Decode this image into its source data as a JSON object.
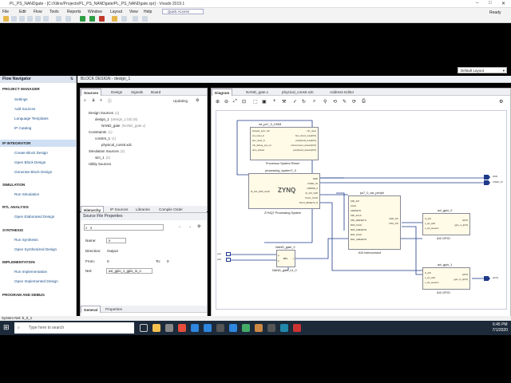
{
  "window": {
    "title": "PL_PS_NANDgate - [C:/Xilinx/Projects/PL_PS_NANDgate/PL_PS_NANDgate.xpr] - Vivado 2019.1",
    "status": "Ready"
  },
  "menu": [
    "File",
    "Edit",
    "Flow",
    "Tools",
    "Reports",
    "Window",
    "Layout",
    "View",
    "Help"
  ],
  "quick_access": "Quick Access",
  "layout_select": "Default Layout",
  "flow_nav": {
    "title": "Flow Navigator",
    "items": [
      {
        "label": "PROJECT MANAGER",
        "type": "section"
      },
      {
        "label": "Settings",
        "type": "sub"
      },
      {
        "label": "Add Sources",
        "type": "sub"
      },
      {
        "label": "Language Templates",
        "type": "sub"
      },
      {
        "label": "IP Catalog",
        "type": "sub"
      },
      {
        "label": "IP INTEGRATOR",
        "type": "section",
        "selected": true
      },
      {
        "label": "Create Block Design",
        "type": "sub"
      },
      {
        "label": "Open Block Design",
        "type": "sub"
      },
      {
        "label": "Generate Block Design",
        "type": "sub"
      },
      {
        "label": "SIMULATION",
        "type": "section"
      },
      {
        "label": "Run Simulation",
        "type": "sub"
      },
      {
        "label": "RTL ANALYSIS",
        "type": "section"
      },
      {
        "label": "Open Elaborated Design",
        "type": "sub"
      },
      {
        "label": "SYNTHESIS",
        "type": "section"
      },
      {
        "label": "Run Synthesis",
        "type": "sub"
      },
      {
        "label": "Open Synthesized Design",
        "type": "sub"
      },
      {
        "label": "IMPLEMENTATION",
        "type": "section"
      },
      {
        "label": "Run Implementation",
        "type": "sub"
      },
      {
        "label": "Open Implemented Design",
        "type": "sub"
      },
      {
        "label": "PROGRAM AND DEBUG",
        "type": "section"
      }
    ]
  },
  "block_design_bar": "BLOCK DESIGN - design_1",
  "sources": {
    "tabs": [
      "Sources",
      "Design",
      "Signals",
      "Board"
    ],
    "updating": "Updating",
    "tree": [
      {
        "label": "Design Sources",
        "extra": "(1)"
      },
      {
        "label": "design_1",
        "extra": "(design_1.bd) (6)"
      },
      {
        "label": "NAND_gate",
        "extra": "(NAND_gate.v)"
      },
      {
        "label": "Constraints",
        "extra": "(1)"
      },
      {
        "label": "constrs_1",
        "extra": "(1)"
      },
      {
        "label": "physical_constr.xdc",
        "extra": ""
      },
      {
        "label": "Simulation Sources",
        "extra": "(2)"
      },
      {
        "label": "sim_1",
        "extra": "(2)"
      },
      {
        "label": "Utility Sources",
        "extra": ""
      }
    ],
    "bottom_tabs": [
      "Hierarchy",
      "IP Sources",
      "Libraries",
      "Compile Order"
    ]
  },
  "props": {
    "title": "Source File Properties",
    "search_value": "s",
    "name_label": "Name:",
    "name_value": "s",
    "direction_label": "Direction:",
    "direction_value": "Output",
    "from_label": "From:",
    "from_value": "0",
    "to_label": "To:",
    "to_value": "0",
    "net_label": "Net:",
    "net_value": "axi_gpio_1_gpio_io_o",
    "tabs": [
      "General",
      "Properties"
    ]
  },
  "bottom_tabs": [
    "Tcl Console",
    "Messages",
    "Log",
    "Reports",
    "Design Runs"
  ],
  "diagram_tabs": [
    "Diagram",
    "NAND_gate.v",
    "physical_constr.xdc",
    "Address Editor"
  ],
  "blocks": {
    "rst": {
      "title": "rst_ps7_0_100M",
      "caption": "Processor System Reset",
      "ports_left": [
        "slowest_sync_clk",
        "ext_reset_in",
        "aux_reset_in",
        "mb_debug_sys_rst",
        "dcm_locked"
      ],
      "ports_right": [
        "mb_reset",
        "bus_struct_reset[0:0]",
        "peripheral_reset[0:0]",
        "interconnect_aresetn[0:0]",
        "peripheral_aresetn[0:0]"
      ]
    },
    "zynq": {
      "title": "processing_system7_0",
      "caption": "ZYNQ7 Processing System",
      "logo": "ZYNQ",
      "ports_left": [
        "M_AXI_GP0_ACLK"
      ],
      "ports_right": [
        "DDR",
        "FIXED_IO",
        "USBIND_0",
        "M_AXI_GP0",
        "FCLK_CLK0",
        "FCLK_RESET0_N"
      ]
    },
    "axi": {
      "title": "ps7_0_axi_periph",
      "caption": "AXI Interconnect",
      "ports_left": [
        "S00_AXI",
        "ACLK",
        "ARESETN",
        "S00_ACLK",
        "S00_ARESETN",
        "M00_ACLK",
        "M00_ARESETN",
        "M01_ACLK",
        "M01_ARESETN"
      ],
      "ports_right": [
        "M00_AXI",
        "M01_AXI"
      ]
    },
    "gpio0": {
      "title": "axi_gpio_0",
      "caption": "AXI GPIO",
      "ports_left": [
        "S_AXI",
        "s_axi_aclk",
        "s_axi_aresetn"
      ],
      "ports_right": [
        "GPIO",
        "gpio_io_i[0:0]"
      ]
    },
    "gpio1": {
      "title": "axi_gpio_1",
      "caption": "AXI GPIO",
      "ports_left": [
        "S_AXI",
        "s_axi_aclk",
        "s_axi_aresetn"
      ],
      "ports_right": [
        "GPIO",
        "gpio_io_o[0:0]"
      ]
    },
    "nand": {
      "title": "NAND_gate_0",
      "caption": "NAND_gate_v1_0",
      "ports_left": [
        "a",
        "b"
      ],
      "ports_right": [
        "y"
      ],
      "tag": "RTL"
    }
  },
  "ext_ports": {
    "ddr": "DDR",
    "fixed_io": "FIXED_IO",
    "sw1": "sw1",
    "sw0": "sw0",
    "led": "s[0:0]"
  },
  "statusbar": "System Net: b_0_1",
  "taskbar": {
    "search": "Type here to search",
    "time": "6:45 PM",
    "date": "7/1/2020"
  },
  "colors": {
    "accent": "#1e3a8a",
    "block_fill": "#fffbe6",
    "nav_selected": "#cfe0f5"
  }
}
